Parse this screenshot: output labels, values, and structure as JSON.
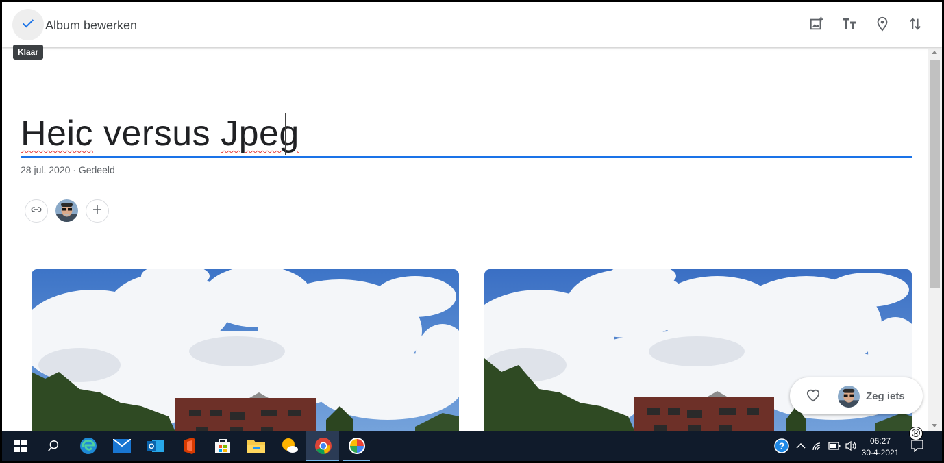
{
  "topbar": {
    "done_tooltip": "Klaar",
    "title": "Album bewerken",
    "tools": [
      "add-photo-icon",
      "text-icon",
      "location-icon",
      "sort-icon"
    ]
  },
  "album": {
    "title_part1": "Heic",
    "title_part2": " versus ",
    "title_part3": "Jpeg",
    "meta": "28 jul. 2020 · Gedeeld"
  },
  "comment": {
    "placeholder": "Zeg iets"
  },
  "taskbar": {
    "time": "06:27",
    "date": "30-4-2021",
    "apps": [
      "start-icon",
      "search-icon",
      "edge-icon",
      "mail-icon",
      "outlook-icon",
      "office-icon",
      "store-icon",
      "explorer-icon",
      "weather-icon",
      "chrome-icon",
      "photos-icon"
    ]
  },
  "colors": {
    "accent": "#1a73e8",
    "taskbar": "#101b2b"
  }
}
